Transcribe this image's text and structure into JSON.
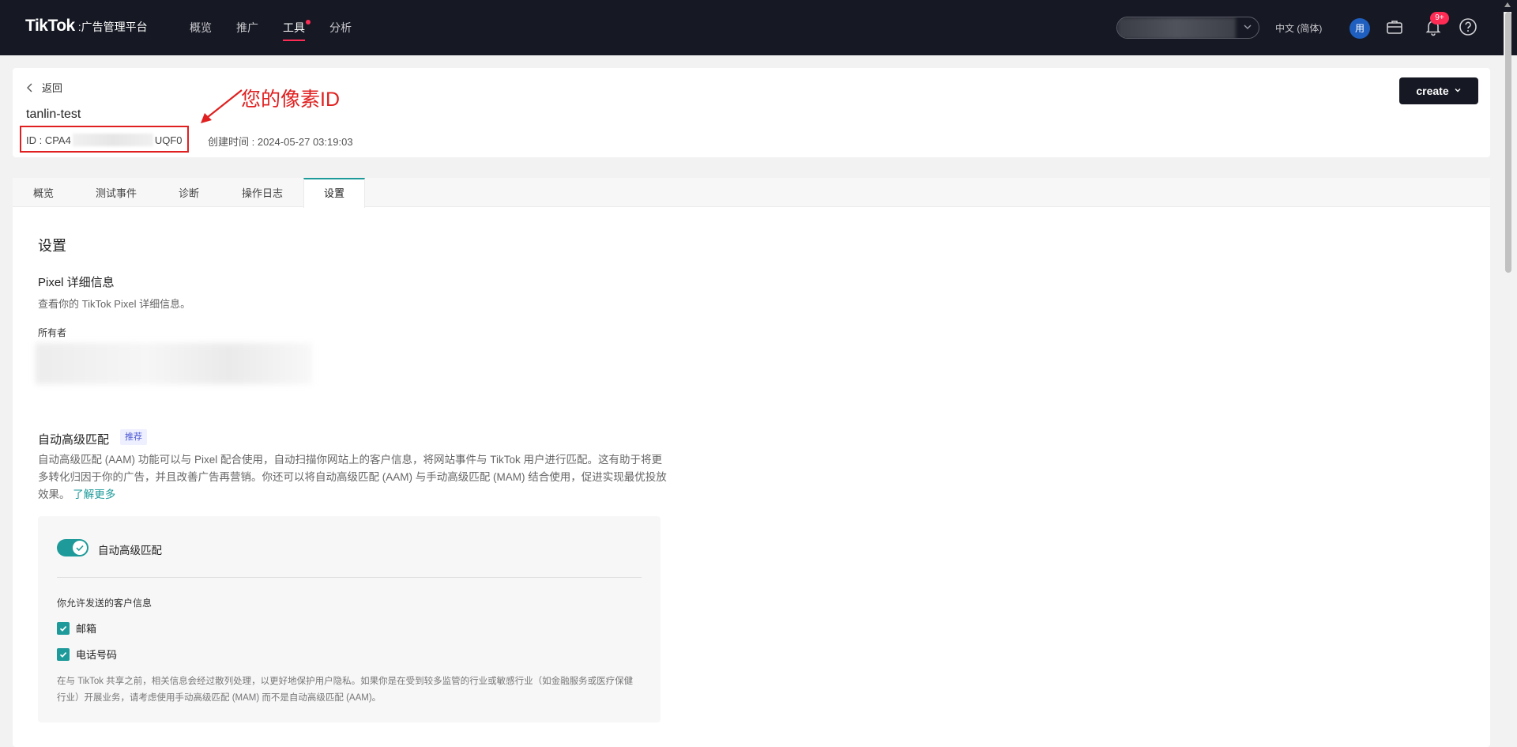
{
  "topbar": {
    "logo_main": "TikTok",
    "logo_sub": ":广告管理平台",
    "nav": [
      {
        "label": "概览"
      },
      {
        "label": "推广"
      },
      {
        "label": "工具"
      },
      {
        "label": "分析"
      }
    ],
    "active_nav": "工具",
    "language": "中文 (简体)",
    "avatar_text": "用",
    "notification_badge": "9+"
  },
  "header": {
    "back_label": "返回",
    "pixel_name": "tanlin-test",
    "id_prefix": "ID : CPA4",
    "id_suffix": "UQF0",
    "created_at": "创建时间 : 2024-05-27 03:19:03",
    "annotation": "您的像素ID",
    "create_button": "create"
  },
  "tabs": [
    {
      "label": "概览"
    },
    {
      "label": "测试事件"
    },
    {
      "label": "诊断"
    },
    {
      "label": "操作日志"
    },
    {
      "label": "设置"
    }
  ],
  "active_tab": "设置",
  "settings": {
    "title": "设置",
    "pixel_details_title": "Pixel 详细信息",
    "pixel_details_desc": "查看你的 TikTok Pixel 详细信息。",
    "owner_label": "所有者",
    "aam": {
      "title": "自动高级匹配",
      "tag": "推荐",
      "desc": "自动高级匹配 (AAM) 功能可以与 Pixel 配合使用，自动扫描你网站上的客户信息，将网站事件与 TikTok 用户进行匹配。这有助于将更多转化归因于你的广告，并且改善广告再营销。你还可以将自动高级匹配 (AAM) 与手动高级匹配 (MAM) 结合使用，促进实现最优投放效果。",
      "learn_more": "了解更多",
      "toggle_label": "自动高级匹配",
      "toggle_on": true,
      "allow_label": "你允许发送的客户信息",
      "options": [
        {
          "label": "邮箱",
          "checked": true
        },
        {
          "label": "电话号码",
          "checked": true
        }
      ],
      "note": "在与 TikTok 共享之前，相关信息会经过散列处理，以更好地保护用户隐私。如果你是在受到较多监管的行业或敏感行业（如金融服务或医疗保健行业）开展业务，请考虑使用手动高级匹配 (MAM) 而不是自动高级匹配 (AAM)。"
    }
  },
  "colors": {
    "topbar_bg": "#161823",
    "accent": "#1e9a9a",
    "annotation_red": "#e02020",
    "nav_active": "#fe2c55"
  }
}
